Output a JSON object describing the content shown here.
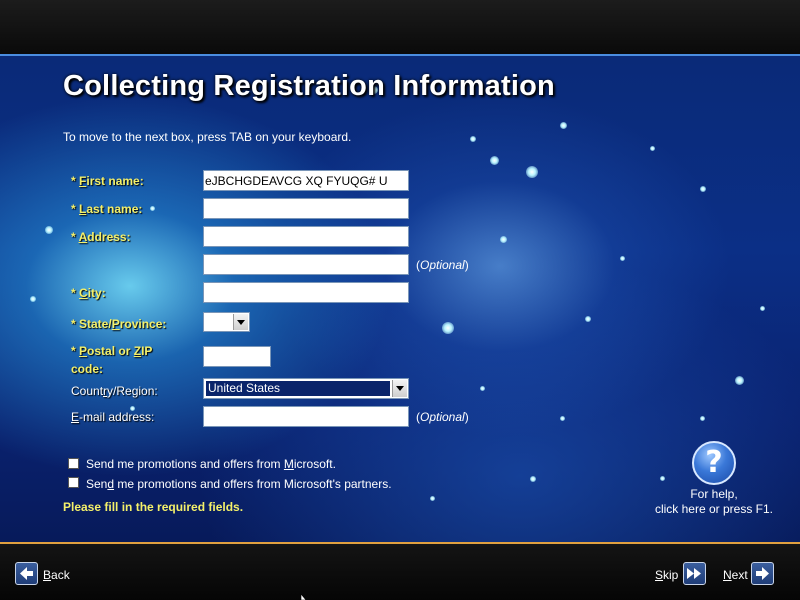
{
  "page": {
    "title": "Collecting Registration Information",
    "instruction": "To move to the next box, press TAB on your keyboard."
  },
  "form": {
    "first_name": {
      "star": "* ",
      "acc": "F",
      "rest": "irst name:",
      "value": "eJBCHGDEAVCG XQ  FYUQG# U"
    },
    "last_name": {
      "star": "* ",
      "acc": "L",
      "rest": "ast name:",
      "value": ""
    },
    "address": {
      "star": "* ",
      "acc": "A",
      "rest": "ddress:",
      "value": ""
    },
    "address2": {
      "value": "",
      "note_open": "(",
      "note_italic": "Optional",
      "note_close": ")"
    },
    "city": {
      "star": "* ",
      "acc": "C",
      "rest": "ity:",
      "value": ""
    },
    "state": {
      "pre": "* State/",
      "acc": "P",
      "rest": "rovince:",
      "value": ""
    },
    "postal": {
      "pre": "* ",
      "acc1": "P",
      "mid": "ostal or ",
      "acc2": "Z",
      "post": "IP",
      "line2": "code:",
      "value": ""
    },
    "country": {
      "pre": "Count",
      "acc": "r",
      "rest": "y/Region:",
      "value": "United States"
    },
    "email": {
      "acc": "E",
      "rest": "-mail address:",
      "value": "",
      "note_open": "(",
      "note_italic": "Optional",
      "note_close": ")"
    }
  },
  "checkboxes": {
    "microsoft": {
      "pre": "Send me promotions and offers from ",
      "acc": "M",
      "rest": "icrosoft.",
      "checked": false
    },
    "partners": {
      "pre": "Sen",
      "acc": "d",
      "rest": " me promotions and offers from Microsoft's partners.",
      "checked": false
    }
  },
  "required_msg": "Please fill in the required fields.",
  "help": {
    "icon_glyph": "?",
    "line1": "For help,",
    "line2": "click here or press F1."
  },
  "nav": {
    "back": {
      "acc": "B",
      "rest": "ack"
    },
    "skip": {
      "acc": "S",
      "rest": "kip"
    },
    "next": {
      "acc": "N",
      "rest": "ext"
    }
  },
  "colors": {
    "panel_blue": "#0b2f86",
    "required_label": "#f4f06a",
    "focus_select": "#0a246a"
  },
  "icons": [
    "back-arrow-icon",
    "skip-double-arrow-icon",
    "next-arrow-icon",
    "help-question-icon",
    "dropdown-arrow-icon",
    "mouse-cursor-icon"
  ]
}
